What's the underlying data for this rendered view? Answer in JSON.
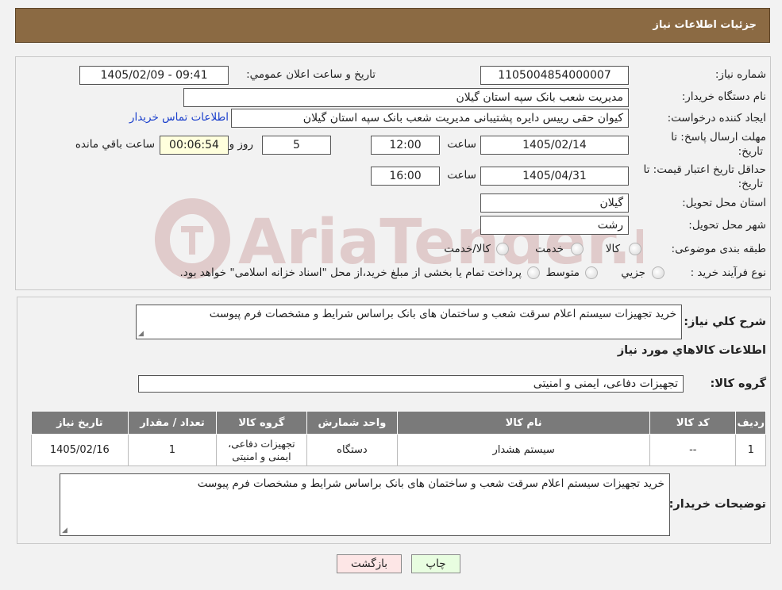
{
  "header": {
    "title": "جزئیات اطلاعات نیاز"
  },
  "form": {
    "need_number_label": "شماره نیاز:",
    "need_number": "1105004854000007",
    "announce_label": "تاریخ و ساعت اعلان عمومي:",
    "announce_value": "1405/02/09 - 09:41",
    "buyer_org_label": "نام دستگاه خريدار:",
    "buyer_org": "مدیریت شعب بانک سپه استان گیلان",
    "creator_label": "ايجاد کننده درخواست:",
    "creator": "کیوان حقی رییس دایره پشتیبانی  مدیریت شعب بانک سپه استان گیلان",
    "contact_link": "اطلاعات تماس خريدار",
    "reply_label_1": "مهلت ارسال پاسخ: تا",
    "reply_label_2": "تاريخ:",
    "reply_date": "1405/02/14",
    "time_label": "ساعت",
    "reply_time": "12:00",
    "days_value": "5",
    "days_label": "روز و",
    "remaining_time": "00:06:54",
    "remaining_label": "ساعت باقي مانده",
    "validity_label_1": "حداقل تاريخ اعتبار قيمت: تا",
    "validity_label_2": "تاريخ:",
    "validity_date": "1405/04/31",
    "validity_time_label": "ساعت",
    "validity_time": "16:00",
    "province_label": "استان محل تحويل:",
    "province": "گیلان",
    "city_label": "شهر محل تحويل:",
    "city": "رشت",
    "category_label": "طبقه بندی موضوعی:",
    "category_options": [
      "کالا",
      "خدمت",
      "کالا/خدمت"
    ],
    "process_label": "نوع فرآيند خريد :",
    "process_options": [
      "جزيي",
      "متوسط"
    ],
    "process_note": "پرداخت تمام يا بخشی از مبلغ خريد،از محل \"اسناد خزانه اسلامی\" خواهد بود."
  },
  "details": {
    "summary_label": "شرح کلي نياز:",
    "summary": "خرید تجهیزات سیستم اعلام سرقت شعب و ساختمان های بانک براساس شرایط و مشخصات فرم پیوست",
    "goods_info_title": "اطلاعات کالاهاي مورد نياز",
    "goods_group_label": "گروه کالا:",
    "goods_group": "تجهیزات دفاعی، ایمنی و امنیتی"
  },
  "table": {
    "headers": [
      "رديف",
      "کد کالا",
      "نام کالا",
      "واحد شمارش",
      "گروه کالا",
      "تعداد / مقدار",
      "تاريخ نياز"
    ],
    "rows": [
      {
        "row": "1",
        "code": "--",
        "name": "سیستم هشدار",
        "unit": "دستگاه",
        "group_1": "تجهیزات دفاعی،",
        "group_2": "ایمنی و امنیتی",
        "qty": "1",
        "date": "1405/02/16"
      }
    ]
  },
  "notes": {
    "label": "توضيحات خريدار:",
    "text": "خرید تجهیزات سیستم اعلام سرقت شعب و ساختمان های بانک براساس شرایط و مشخصات فرم پیوست"
  },
  "buttons": {
    "print": "چاپ",
    "back": "بازگشت"
  },
  "watermark": {
    "text": "AriaTender.neT"
  },
  "colors": {
    "header_bg": "#8b6a43",
    "table_header_bg": "#7a7a7a",
    "link": "#1a3fcc",
    "print_button_bg": "#e8fde0",
    "back_button_bg": "#fde6e6",
    "timer_bg": "#ffffdd"
  }
}
